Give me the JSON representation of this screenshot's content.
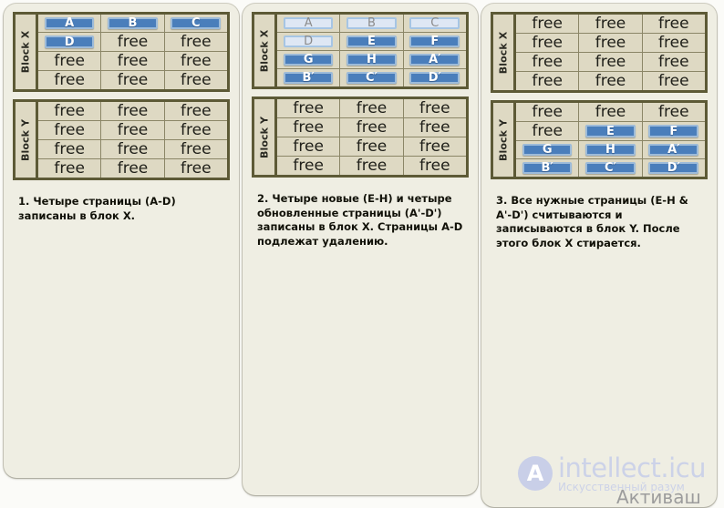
{
  "panels": [
    {
      "id": "panel-1",
      "blocks": [
        {
          "label": "Block X",
          "rows": [
            [
              {
                "kind": "tile",
                "state": "active",
                "text": "A"
              },
              {
                "kind": "tile",
                "state": "active",
                "text": "B"
              },
              {
                "kind": "tile",
                "state": "active",
                "text": "C"
              }
            ],
            [
              {
                "kind": "tile",
                "state": "active",
                "text": "D"
              },
              {
                "kind": "free",
                "text": "free"
              },
              {
                "kind": "free",
                "text": "free"
              }
            ],
            [
              {
                "kind": "free",
                "text": "free"
              },
              {
                "kind": "free",
                "text": "free"
              },
              {
                "kind": "free",
                "text": "free"
              }
            ],
            [
              {
                "kind": "free",
                "text": "free"
              },
              {
                "kind": "free",
                "text": "free"
              },
              {
                "kind": "free",
                "text": "free"
              }
            ]
          ]
        },
        {
          "label": "Block Y",
          "rows": [
            [
              {
                "kind": "free",
                "text": "free"
              },
              {
                "kind": "free",
                "text": "free"
              },
              {
                "kind": "free",
                "text": "free"
              }
            ],
            [
              {
                "kind": "free",
                "text": "free"
              },
              {
                "kind": "free",
                "text": "free"
              },
              {
                "kind": "free",
                "text": "free"
              }
            ],
            [
              {
                "kind": "free",
                "text": "free"
              },
              {
                "kind": "free",
                "text": "free"
              },
              {
                "kind": "free",
                "text": "free"
              }
            ],
            [
              {
                "kind": "free",
                "text": "free"
              },
              {
                "kind": "free",
                "text": "free"
              },
              {
                "kind": "free",
                "text": "free"
              }
            ]
          ]
        }
      ],
      "caption": "1. Четыре страницы (A-D) записаны в блок X."
    },
    {
      "id": "panel-2",
      "blocks": [
        {
          "label": "Block X",
          "rows": [
            [
              {
                "kind": "tile",
                "state": "faded",
                "text": "A"
              },
              {
                "kind": "tile",
                "state": "faded",
                "text": "B"
              },
              {
                "kind": "tile",
                "state": "faded",
                "text": "C"
              }
            ],
            [
              {
                "kind": "tile",
                "state": "faded",
                "text": "D"
              },
              {
                "kind": "tile",
                "state": "active",
                "text": "E"
              },
              {
                "kind": "tile",
                "state": "active",
                "text": "F"
              }
            ],
            [
              {
                "kind": "tile",
                "state": "active",
                "text": "G"
              },
              {
                "kind": "tile",
                "state": "active",
                "text": "H"
              },
              {
                "kind": "tile",
                "state": "active",
                "text": "A′"
              }
            ],
            [
              {
                "kind": "tile",
                "state": "active",
                "text": "B′"
              },
              {
                "kind": "tile",
                "state": "active",
                "text": "C′"
              },
              {
                "kind": "tile",
                "state": "active",
                "text": "D′"
              }
            ]
          ]
        },
        {
          "label": "Block Y",
          "rows": [
            [
              {
                "kind": "free",
                "text": "free"
              },
              {
                "kind": "free",
                "text": "free"
              },
              {
                "kind": "free",
                "text": "free"
              }
            ],
            [
              {
                "kind": "free",
                "text": "free"
              },
              {
                "kind": "free",
                "text": "free"
              },
              {
                "kind": "free",
                "text": "free"
              }
            ],
            [
              {
                "kind": "free",
                "text": "free"
              },
              {
                "kind": "free",
                "text": "free"
              },
              {
                "kind": "free",
                "text": "free"
              }
            ],
            [
              {
                "kind": "free",
                "text": "free"
              },
              {
                "kind": "free",
                "text": "free"
              },
              {
                "kind": "free",
                "text": "free"
              }
            ]
          ]
        }
      ],
      "caption": "2. Четыре новые (E-H) и четыре обновленные страницы (A'-D') записаны в блок X. Страницы A-D подлежат удалению."
    },
    {
      "id": "panel-3",
      "blocks": [
        {
          "label": "Block X",
          "rows": [
            [
              {
                "kind": "free",
                "text": "free"
              },
              {
                "kind": "free",
                "text": "free"
              },
              {
                "kind": "free",
                "text": "free"
              }
            ],
            [
              {
                "kind": "free",
                "text": "free"
              },
              {
                "kind": "free",
                "text": "free"
              },
              {
                "kind": "free",
                "text": "free"
              }
            ],
            [
              {
                "kind": "free",
                "text": "free"
              },
              {
                "kind": "free",
                "text": "free"
              },
              {
                "kind": "free",
                "text": "free"
              }
            ],
            [
              {
                "kind": "free",
                "text": "free"
              },
              {
                "kind": "free",
                "text": "free"
              },
              {
                "kind": "free",
                "text": "free"
              }
            ]
          ]
        },
        {
          "label": "Block Y",
          "rows": [
            [
              {
                "kind": "free",
                "text": "free"
              },
              {
                "kind": "free",
                "text": "free"
              },
              {
                "kind": "free",
                "text": "free"
              }
            ],
            [
              {
                "kind": "free",
                "text": "free"
              },
              {
                "kind": "tile",
                "state": "active",
                "text": "E"
              },
              {
                "kind": "tile",
                "state": "active",
                "text": "F"
              }
            ],
            [
              {
                "kind": "tile",
                "state": "active",
                "text": "G"
              },
              {
                "kind": "tile",
                "state": "active",
                "text": "H"
              },
              {
                "kind": "tile",
                "state": "active",
                "text": "A′"
              }
            ],
            [
              {
                "kind": "tile",
                "state": "active",
                "text": "B′"
              },
              {
                "kind": "tile",
                "state": "active",
                "text": "C′"
              },
              {
                "kind": "tile",
                "state": "active",
                "text": "D′"
              }
            ]
          ]
        }
      ],
      "caption": "3. Все нужные страницы (E-H & A'-D') считываются и записываются в блок Y. После этого блок X стирается."
    }
  ],
  "watermark": {
    "logo_letter": "A",
    "title": "intellect.icu",
    "subtitle": "Искусственный разум",
    "activate_text": "Активаш"
  },
  "colors": {
    "tile_active": "#4a7ebb",
    "tile_active_border": "#9dbbd9",
    "tile_faded": "#dee7f4",
    "tile_faded_border": "#a6c5e4",
    "grid_bg": "#ded9c3",
    "grid_border": "#5d5a36",
    "panel_bg": "#efeee3"
  }
}
